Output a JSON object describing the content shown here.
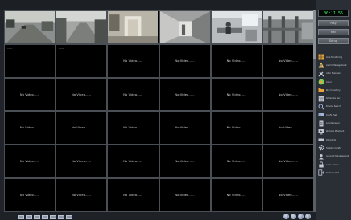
{
  "clock": "00:11:55",
  "top_buttons": [
    "Play",
    "Rec",
    "Setup"
  ],
  "no_video_label": "No Video......",
  "live_cells": [
    {
      "scene": "street"
    },
    {
      "scene": "parking"
    },
    {
      "scene": "entrance"
    },
    {
      "scene": "corridor"
    },
    {
      "scene": "office"
    },
    {
      "scene": "gate"
    }
  ],
  "menu": [
    {
      "icon": "grid-icon",
      "label": "Live Monitoring",
      "color": "#e8a33a"
    },
    {
      "icon": "alarm-icon",
      "label": "Alarm Management",
      "color": "#e5c16b"
    },
    {
      "icon": "tools-icon",
      "label": "Auto Maintain",
      "color": "#c0c7d2"
    },
    {
      "icon": "color-icon",
      "label": "Color",
      "color": "#7fcf5a"
    },
    {
      "icon": "folder-icon",
      "label": "Rec Directory",
      "color": "#e8a33a"
    },
    {
      "icon": "schedule-icon",
      "label": "Schedule Rec",
      "color": "#c0c7d2"
    },
    {
      "icon": "device-icon",
      "label": "Device Search",
      "color": "#9fb4d8"
    },
    {
      "icon": "config-icon",
      "label": "Config Set",
      "color": "#9fb4d8"
    },
    {
      "icon": "log-icon",
      "label": "Log Manager",
      "color": "#c0c7d2"
    },
    {
      "icon": "playback-icon",
      "label": "Remote Playback",
      "color": "#c0c7d2"
    },
    {
      "icon": "ptz-icon",
      "label": "P. Control",
      "color": "#c0c7d2"
    },
    {
      "icon": "gear-icon",
      "label": "System Config",
      "color": "#c0c7d2"
    },
    {
      "icon": "user-icon",
      "label": "Account Management",
      "color": "#c0c7d2"
    },
    {
      "icon": "lock-icon",
      "label": "Lock Screen",
      "color": "#c0c7d2"
    },
    {
      "icon": "exit-icon",
      "label": "System Quit",
      "color": "#c0c7d2"
    }
  ]
}
